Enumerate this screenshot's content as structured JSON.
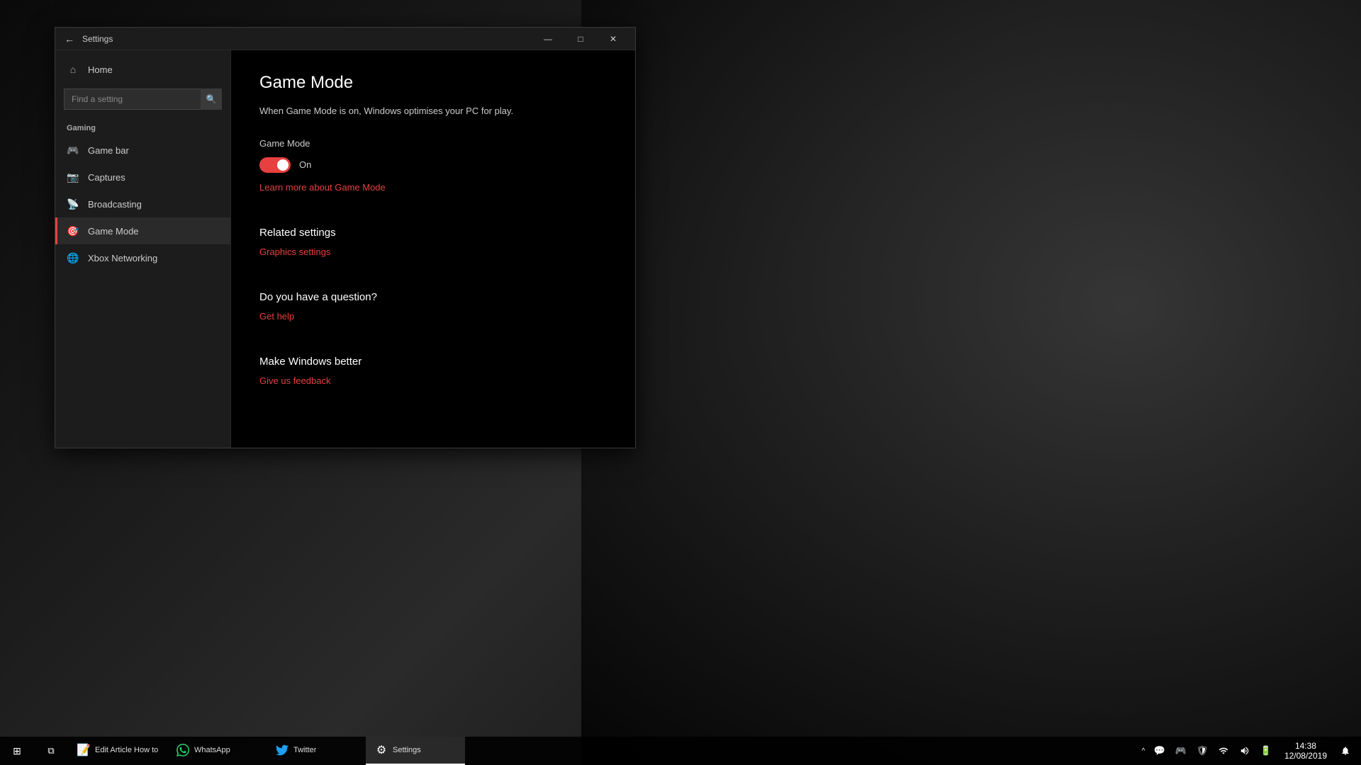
{
  "window": {
    "title": "Settings",
    "back_label": "←",
    "minimize": "—",
    "maximize": "□",
    "close": "✕"
  },
  "sidebar": {
    "home_label": "Home",
    "search_placeholder": "Find a setting",
    "section_title": "Gaming",
    "items": [
      {
        "id": "game-bar",
        "label": "Game bar",
        "icon": "🎮"
      },
      {
        "id": "captures",
        "label": "Captures",
        "icon": "📷"
      },
      {
        "id": "broadcasting",
        "label": "Broadcasting",
        "icon": "📡"
      },
      {
        "id": "game-mode",
        "label": "Game Mode",
        "icon": "🎯",
        "active": true
      },
      {
        "id": "xbox-networking",
        "label": "Xbox Networking",
        "icon": "🌐"
      }
    ]
  },
  "main": {
    "title": "Game Mode",
    "description": "When Game Mode is on, Windows optimises your PC for play.",
    "toggle_section_label": "Game Mode",
    "toggle_state": "On",
    "toggle_on": true,
    "learn_more_link": "Learn more about Game Mode",
    "related_settings_title": "Related settings",
    "graphics_settings_link": "Graphics settings",
    "question_title": "Do you have a question?",
    "get_help_link": "Get help",
    "make_better_title": "Make Windows better",
    "feedback_link": "Give us feedback"
  },
  "taskbar": {
    "start_icon": "⊞",
    "search_icon": "⧉",
    "items": [
      {
        "id": "edit-article",
        "label": "Edit Article How to",
        "icon": "📝",
        "active": false
      },
      {
        "id": "whatsapp",
        "label": "WhatsApp",
        "icon": "💬",
        "active": false
      },
      {
        "id": "twitter",
        "label": "Twitter",
        "icon": "🐦",
        "active": false
      },
      {
        "id": "settings",
        "label": "Settings",
        "icon": "⚙",
        "active": true
      }
    ],
    "tray": {
      "expand": "^",
      "icons": [
        "🔊",
        "📶",
        "🔋",
        "🛡",
        "💬",
        "🎮"
      ],
      "time": "14:38",
      "date": "12/08/2019"
    }
  }
}
